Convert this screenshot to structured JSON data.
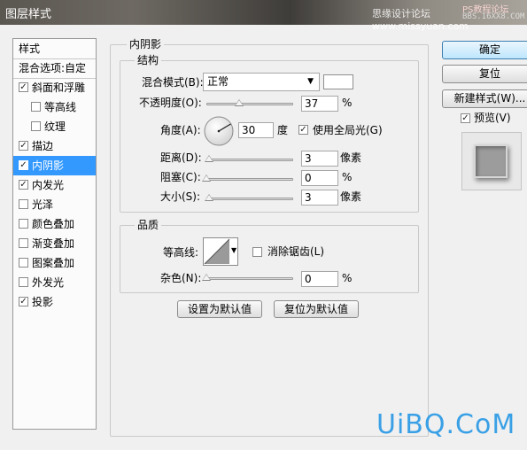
{
  "window": {
    "title": "图层样式",
    "watermark_top": "思缘设计论坛 www.missyuan.com",
    "watermark_ps": "PS教程论坛",
    "watermark_bbs": "BBS.16XX8.COM"
  },
  "sidebar": {
    "header": "样式",
    "blend_options": "混合选项:自定",
    "items": [
      {
        "label": "斜面和浮雕",
        "checked": true
      },
      {
        "label": "等高线",
        "checked": false
      },
      {
        "label": "纹理",
        "checked": false
      },
      {
        "label": "描边",
        "checked": true
      },
      {
        "label": "内阴影",
        "checked": true,
        "selected": true
      },
      {
        "label": "内发光",
        "checked": true
      },
      {
        "label": "光泽",
        "checked": false
      },
      {
        "label": "颜色叠加",
        "checked": false
      },
      {
        "label": "渐变叠加",
        "checked": false
      },
      {
        "label": "图案叠加",
        "checked": false
      },
      {
        "label": "外发光",
        "checked": false
      },
      {
        "label": "投影",
        "checked": true
      }
    ]
  },
  "panel": {
    "title": "内阴影",
    "structure": {
      "title": "结构",
      "blend_mode_label": "混合模式(B):",
      "blend_mode_value": "正常",
      "shadow_color": "#ffffff",
      "opacity_label": "不透明度(O):",
      "opacity_value": "37",
      "opacity_unit": "%",
      "angle_label": "角度(A):",
      "angle_value": "30",
      "angle_unit": "度",
      "global_light_label": "使用全局光(G)",
      "global_light_checked": true,
      "distance_label": "距离(D):",
      "distance_value": "3",
      "distance_unit": "像素",
      "choke_label": "阻塞(C):",
      "choke_value": "0",
      "choke_unit": "%",
      "size_label": "大小(S):",
      "size_value": "3",
      "size_unit": "像素"
    },
    "quality": {
      "title": "品质",
      "contour_label": "等高线:",
      "antialias_label": "消除锯齿(L)",
      "antialias_checked": false,
      "noise_label": "杂色(N):",
      "noise_value": "0",
      "noise_unit": "%"
    },
    "set_default": "设置为默认值",
    "reset_default": "复位为默认值"
  },
  "actions": {
    "ok": "确定",
    "reset": "复位",
    "new_style": "新建样式(W)...",
    "preview_label": "预览(V)",
    "preview_checked": true
  },
  "site_watermark": "UiBQ.CoM"
}
